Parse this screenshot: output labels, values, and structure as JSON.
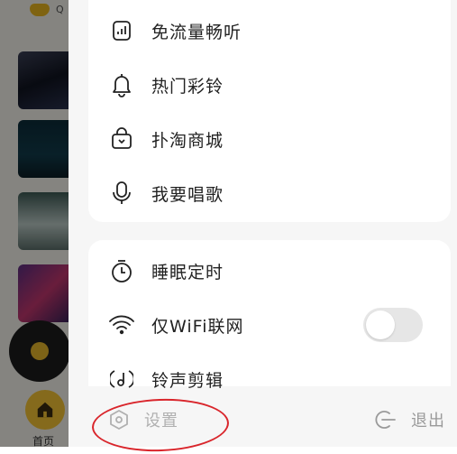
{
  "background_app": {
    "logo_icon": "app-logo",
    "logo_text": "Q",
    "home_label": "首页",
    "home_icon": "home-icon"
  },
  "menu": {
    "section1": [
      {
        "label": "免流量畅听",
        "icon": "data-saver-icon"
      },
      {
        "label": "热门彩铃",
        "icon": "bell-icon"
      },
      {
        "label": "扑淘商城",
        "icon": "shopping-bag-icon"
      },
      {
        "label": "我要唱歌",
        "icon": "microphone-icon"
      }
    ],
    "section2": [
      {
        "label": "睡眠定时",
        "icon": "timer-icon"
      },
      {
        "label": "仅WiFi联网",
        "icon": "wifi-icon",
        "toggle": false
      },
      {
        "label": "铃声剪辑",
        "icon": "ringtone-edit-icon"
      }
    ]
  },
  "bottom_bar": {
    "settings_label": "设置",
    "settings_icon": "settings-hexagon-icon",
    "exit_label": "退出",
    "exit_icon": "exit-icon"
  },
  "colors": {
    "accent": "#f3c233",
    "annotation": "#d9252b",
    "toggle_off": "#e6e6e6",
    "drawer_bg": "#f6f6f6"
  }
}
